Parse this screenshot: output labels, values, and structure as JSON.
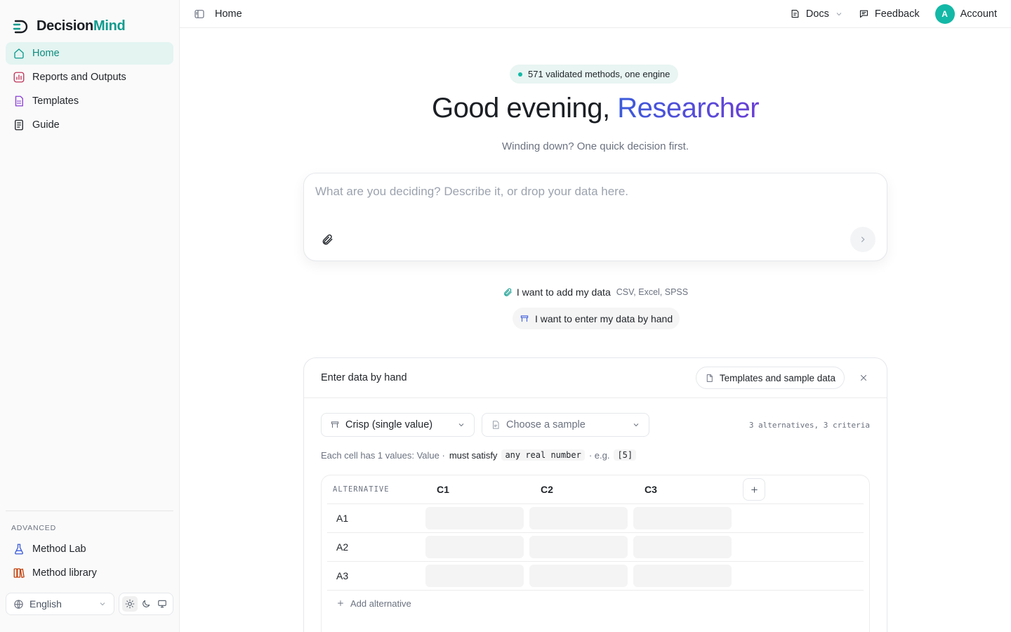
{
  "brand": {
    "name_part1": "Decision",
    "name_part2": "Mind"
  },
  "sidebar": {
    "items": [
      {
        "label": "Home",
        "icon": "home-icon"
      },
      {
        "label": "Reports and Outputs",
        "icon": "chart-icon"
      },
      {
        "label": "Templates",
        "icon": "template-icon"
      },
      {
        "label": "Guide",
        "icon": "book-icon"
      }
    ],
    "advanced_heading": "ADVANCED",
    "advanced_items": [
      {
        "label": "Method Lab",
        "icon": "flask-icon"
      },
      {
        "label": "Method library",
        "icon": "library-icon"
      }
    ],
    "language": "English"
  },
  "topbar": {
    "page": "Home",
    "docs": "Docs",
    "feedback": "Feedback",
    "avatar_initial": "A",
    "account": "Account"
  },
  "hero": {
    "pill": "571 validated methods, one engine",
    "greeting": "Good evening, ",
    "name": "Researcher",
    "subtitle": "Winding down? One quick decision first."
  },
  "composer": {
    "placeholder": "What are you deciding? Describe it, or drop your data here.",
    "value": ""
  },
  "options": {
    "add_data": "I want to add my data",
    "add_data_hint": "CSV, Excel, SPSS",
    "enter_by_hand": "I want to enter my data by hand"
  },
  "panel": {
    "title": "Enter data by hand",
    "templates_button": "Templates and sample data",
    "mode_select": "Crisp (single value)",
    "sample_select": "Choose a sample",
    "counts": "3 alternatives, 3 criteria",
    "rule": {
      "prefix": "Each cell has 1 values: Value ·",
      "strong": "must satisfy",
      "code1": "any real number",
      "eg": "· e.g.",
      "code2": "[5]"
    },
    "table": {
      "alt_header": "ALTERNATIVE",
      "criteria": [
        "C1",
        "C2",
        "C3"
      ],
      "rows": [
        "A1",
        "A2",
        "A3"
      ],
      "add_row": "Add alternative"
    }
  },
  "colors": {
    "accent": "#0f9b8e",
    "active_bg": "#e3f4f1",
    "gradient_start": "#3b5bdb",
    "gradient_end": "#6a3fd6"
  }
}
